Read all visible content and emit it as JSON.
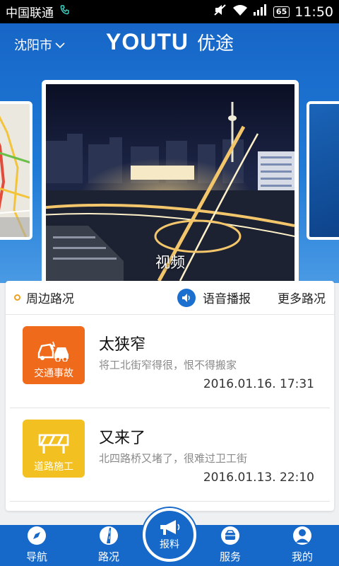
{
  "status_bar": {
    "carrier": "中国联通",
    "battery": "65",
    "time": "11:50"
  },
  "header": {
    "city": "沈阳市",
    "logo_en": "YOUTU",
    "logo_cn": "优途"
  },
  "carousel": {
    "main_caption": "视频"
  },
  "traffic": {
    "title": "周边路况",
    "voice_label": "语音播报",
    "more_label": "更多路况",
    "items": [
      {
        "category": "交通事故",
        "title": "太狭窄",
        "description": "将工北街窄得很，恨不得搬家",
        "time": "2016.01.16. 17:31",
        "color": "#f06a1c"
      },
      {
        "category": "道路施工",
        "title": "又来了",
        "description": "北四路桥又堵了，很难过卫工街",
        "time": "2016.01.13. 22:10",
        "color": "#f2c020"
      }
    ]
  },
  "bottom_nav": {
    "navigate": "导航",
    "road": "路况",
    "report": "报料",
    "service": "服务",
    "mine": "我的"
  },
  "colors": {
    "primary": "#1668c9",
    "accident": "#f06a1c",
    "construction": "#f2c020"
  }
}
